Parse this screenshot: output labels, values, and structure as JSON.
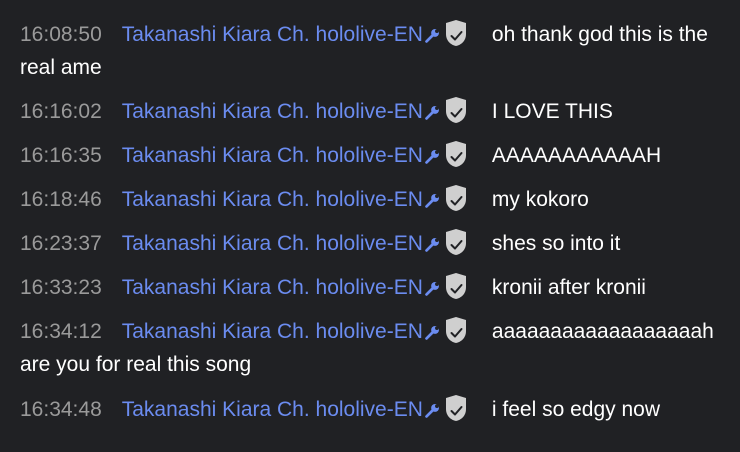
{
  "messages": [
    {
      "time": "16:08:50",
      "author": "Takanashi Kiara Ch. hololive-EN",
      "text": "oh thank god this is the real ame"
    },
    {
      "time": "16:16:02",
      "author": "Takanashi Kiara Ch. hololive-EN",
      "text": "I LOVE THIS"
    },
    {
      "time": "16:16:35",
      "author": "Takanashi Kiara Ch. hololive-EN",
      "text": "AAAAAAAAAAAH"
    },
    {
      "time": "16:18:46",
      "author": "Takanashi Kiara Ch. hololive-EN",
      "text": "my kokoro"
    },
    {
      "time": "16:23:37",
      "author": "Takanashi Kiara Ch. hololive-EN",
      "text": "shes so into it"
    },
    {
      "time": "16:33:23",
      "author": "Takanashi Kiara Ch. hololive-EN",
      "text": "kronii after kronii"
    },
    {
      "time": "16:34:12",
      "author": "Takanashi Kiara Ch. hololive-EN",
      "text": "aaaaaaaaaaaaaaaaaah are you for real this song"
    },
    {
      "time": "16:34:48",
      "author": "Takanashi Kiara Ch. hololive-EN",
      "text": "i feel so edgy now"
    }
  ],
  "badges": {
    "moderator_icon": "wrench-icon",
    "verified_icon": "verified-shield-icon"
  },
  "colors": {
    "background": "#202124",
    "timestamp": "#9a9a9a",
    "author": "#6b8cf0",
    "message": "#ffffff"
  }
}
